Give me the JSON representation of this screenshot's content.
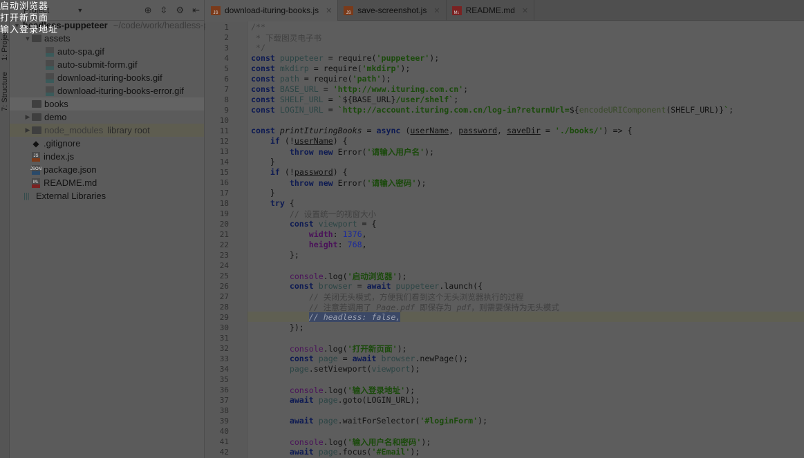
{
  "overlay_log": [
    "启动浏览器",
    "打开新页面",
    "输入登录地址"
  ],
  "tool_tabs": {
    "project": "1: Project",
    "structure": "7: Structure"
  },
  "sidebar": {
    "view_select": "Project",
    "root": {
      "name": "headless-puppeteer",
      "path": "~/code/work/headless-puppeteer"
    },
    "items": [
      {
        "label": "assets",
        "type": "folder",
        "level": 1,
        "expanded": true
      },
      {
        "label": "auto-spa.gif",
        "type": "image",
        "level": 2
      },
      {
        "label": "auto-submit-form.gif",
        "type": "image",
        "level": 2
      },
      {
        "label": "download-ituring-books.gif",
        "type": "image",
        "level": 2
      },
      {
        "label": "download-ituring-books-error.gif",
        "type": "image",
        "level": 2
      },
      {
        "label": "books",
        "type": "folder",
        "level": 1,
        "selected": true
      },
      {
        "label": "demo",
        "type": "folder",
        "level": 1,
        "collapsed": true
      },
      {
        "label": "node_modules",
        "suffix": "library root",
        "type": "folder",
        "level": 1,
        "collapsed": true,
        "excluded": true
      },
      {
        "label": ".gitignore",
        "type": "git",
        "level": 1
      },
      {
        "label": "index.js",
        "type": "js",
        "level": 1
      },
      {
        "label": "package.json",
        "type": "json",
        "level": 1
      },
      {
        "label": "README.md",
        "type": "md",
        "level": 1
      }
    ],
    "external": "External Libraries"
  },
  "tabs": [
    {
      "label": "download-ituring-books.js",
      "icon": "js",
      "active": true
    },
    {
      "label": "save-screenshot.js",
      "icon": "js"
    },
    {
      "label": "README.md",
      "icon": "md"
    }
  ],
  "editor": {
    "current_line": 29,
    "lines": [
      [
        [
          "c",
          "/**"
        ]
      ],
      [
        [
          "c",
          " * 下载图灵电子书"
        ]
      ],
      [
        [
          "c",
          " */"
        ]
      ],
      [
        [
          "k",
          "const "
        ],
        [
          "v",
          "puppeteer"
        ],
        [
          "p",
          " = require("
        ],
        [
          "s",
          "'puppeteer'"
        ],
        [
          "p",
          ");"
        ]
      ],
      [
        [
          "k",
          "const "
        ],
        [
          "v",
          "mkdirp"
        ],
        [
          "p",
          " = require("
        ],
        [
          "s",
          "'mkdirp'"
        ],
        [
          "p",
          ");"
        ]
      ],
      [
        [
          "k",
          "const "
        ],
        [
          "v",
          "path"
        ],
        [
          "p",
          " = require("
        ],
        [
          "s",
          "'path'"
        ],
        [
          "p",
          ");"
        ]
      ],
      [
        [
          "k",
          "const "
        ],
        [
          "v",
          "BASE_URL"
        ],
        [
          "p",
          " = "
        ],
        [
          "s",
          "'http://www.ituring.com.cn'"
        ],
        [
          "p",
          ";"
        ]
      ],
      [
        [
          "k",
          "const "
        ],
        [
          "v",
          "SHELF_URL"
        ],
        [
          "p",
          " = "
        ],
        [
          "s",
          "`"
        ],
        [
          "p",
          "${BASE_URL}"
        ],
        [
          "s",
          "/user/shelf`"
        ],
        [
          "p",
          ";"
        ]
      ],
      [
        [
          "k",
          "const "
        ],
        [
          "v",
          "LOGIN_URL"
        ],
        [
          "p",
          " = "
        ],
        [
          "s",
          "`http://account.ituring.com.cn/log-in?returnUrl="
        ],
        [
          "p",
          "${"
        ],
        [
          "st",
          "encodeURIComponent"
        ],
        [
          "p",
          "(SHELF_URL)}"
        ],
        [
          "s",
          "`"
        ],
        [
          "p",
          ";"
        ]
      ],
      [],
      [
        [
          "k",
          "const "
        ],
        [
          "i",
          "printIturingBooks"
        ],
        [
          "p",
          " = "
        ],
        [
          "k",
          "async "
        ],
        [
          "p",
          "("
        ],
        [
          "u",
          "userName"
        ],
        [
          "p",
          ", "
        ],
        [
          "u",
          "password"
        ],
        [
          "p",
          ", "
        ],
        [
          "u",
          "saveDir"
        ],
        [
          "p",
          " = "
        ],
        [
          "s",
          "'./books/'"
        ],
        [
          "p",
          ") => {"
        ]
      ],
      [
        [
          "p",
          "    "
        ],
        [
          "k",
          "if "
        ],
        [
          "p",
          "(!"
        ],
        [
          "u",
          "userName"
        ],
        [
          "p",
          ") {"
        ]
      ],
      [
        [
          "p",
          "        "
        ],
        [
          "k",
          "throw new "
        ],
        [
          "p",
          "Error("
        ],
        [
          "s",
          "'请输入用户名'"
        ],
        [
          "p",
          ");"
        ]
      ],
      [
        [
          "p",
          "    }"
        ]
      ],
      [
        [
          "p",
          "    "
        ],
        [
          "k",
          "if "
        ],
        [
          "p",
          "(!"
        ],
        [
          "u",
          "password"
        ],
        [
          "p",
          ") {"
        ]
      ],
      [
        [
          "p",
          "        "
        ],
        [
          "k",
          "throw new "
        ],
        [
          "p",
          "Error("
        ],
        [
          "s",
          "'请输入密码'"
        ],
        [
          "p",
          ");"
        ]
      ],
      [
        [
          "p",
          "    }"
        ]
      ],
      [
        [
          "p",
          "    "
        ],
        [
          "k",
          "try "
        ],
        [
          "p",
          "{"
        ]
      ],
      [
        [
          "p",
          "        "
        ],
        [
          "c",
          "// 设置统一的视窗大小"
        ]
      ],
      [
        [
          "p",
          "        "
        ],
        [
          "k",
          "const "
        ],
        [
          "v",
          "viewport"
        ],
        [
          "p",
          " = {"
        ]
      ],
      [
        [
          "p",
          "            "
        ],
        [
          "f",
          "width"
        ],
        [
          "p",
          ": "
        ],
        [
          "n",
          "1376"
        ],
        [
          "p",
          ","
        ]
      ],
      [
        [
          "p",
          "            "
        ],
        [
          "f",
          "height"
        ],
        [
          "p",
          ": "
        ],
        [
          "n",
          "768"
        ],
        [
          "p",
          ","
        ]
      ],
      [
        [
          "p",
          "        };"
        ]
      ],
      [],
      [
        [
          "p",
          "        "
        ],
        [
          "cs",
          "console"
        ],
        [
          "p",
          ".log("
        ],
        [
          "s",
          "'启动浏览器'"
        ],
        [
          "p",
          ");"
        ]
      ],
      [
        [
          "p",
          "        "
        ],
        [
          "k",
          "const "
        ],
        [
          "v",
          "browser"
        ],
        [
          "p",
          " = "
        ],
        [
          "k",
          "await "
        ],
        [
          "v",
          "puppeteer"
        ],
        [
          "p",
          ".launch({"
        ]
      ],
      [
        [
          "p",
          "            "
        ],
        [
          "c",
          "// 关闭无头模式，方便我们看到这个无头浏览器执行的过程"
        ]
      ],
      [
        [
          "p",
          "            "
        ],
        [
          "c",
          "// 注意若调用了 "
        ],
        [
          "ci",
          "Page.pdf"
        ],
        [
          "c",
          " 即保存为 "
        ],
        [
          "ci",
          "pdf"
        ],
        [
          "c",
          "，则需要保持为无头模式"
        ]
      ],
      [
        [
          "p",
          "            "
        ],
        [
          "sel",
          "// headless: false,"
        ]
      ],
      [
        [
          "p",
          "        });"
        ]
      ],
      [],
      [
        [
          "p",
          "        "
        ],
        [
          "cs",
          "console"
        ],
        [
          "p",
          ".log("
        ],
        [
          "s",
          "'打开新页面'"
        ],
        [
          "p",
          ");"
        ]
      ],
      [
        [
          "p",
          "        "
        ],
        [
          "k",
          "const "
        ],
        [
          "v",
          "page"
        ],
        [
          "p",
          " = "
        ],
        [
          "k",
          "await "
        ],
        [
          "v",
          "browser"
        ],
        [
          "p",
          ".newPage();"
        ]
      ],
      [
        [
          "p",
          "        "
        ],
        [
          "v",
          "page"
        ],
        [
          "p",
          ".setViewport("
        ],
        [
          "v",
          "viewport"
        ],
        [
          "p",
          ");"
        ]
      ],
      [],
      [
        [
          "p",
          "        "
        ],
        [
          "cs",
          "console"
        ],
        [
          "p",
          ".log("
        ],
        [
          "s",
          "'输入登录地址'"
        ],
        [
          "p",
          ");"
        ]
      ],
      [
        [
          "p",
          "        "
        ],
        [
          "k",
          "await "
        ],
        [
          "v",
          "page"
        ],
        [
          "p",
          ".goto(LOGIN_URL);"
        ]
      ],
      [],
      [
        [
          "p",
          "        "
        ],
        [
          "k",
          "await "
        ],
        [
          "v",
          "page"
        ],
        [
          "p",
          ".waitForSelector("
        ],
        [
          "s",
          "'#loginForm'"
        ],
        [
          "p",
          ");"
        ]
      ],
      [],
      [
        [
          "p",
          "        "
        ],
        [
          "cs",
          "console"
        ],
        [
          "p",
          ".log("
        ],
        [
          "s",
          "'输入用户名和密码'"
        ],
        [
          "p",
          ");"
        ]
      ],
      [
        [
          "p",
          "        "
        ],
        [
          "k",
          "await "
        ],
        [
          "v",
          "page"
        ],
        [
          "p",
          ".focus("
        ],
        [
          "s",
          "'#Email'"
        ],
        [
          "p",
          ");"
        ]
      ]
    ]
  }
}
